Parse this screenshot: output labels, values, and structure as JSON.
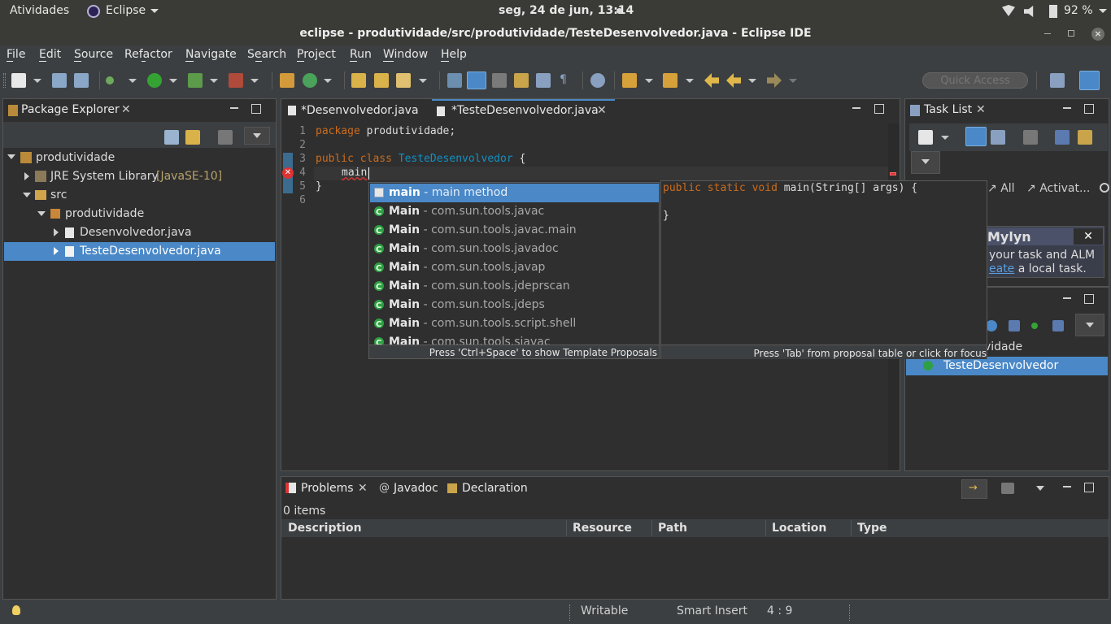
{
  "system": {
    "activities": "Atividades",
    "app_menu": "Eclipse",
    "clock": "seg, 24 de jun, 13:14",
    "battery": "92 %"
  },
  "window": {
    "title": "eclipse - produtividade/src/produtividade/TesteDesenvolvedor.java - Eclipse IDE"
  },
  "menu": [
    "File",
    "Edit",
    "Source",
    "Refactor",
    "Navigate",
    "Search",
    "Project",
    "Run",
    "Window",
    "Help"
  ],
  "menu_underline": [
    "F",
    "E",
    "S",
    "f",
    "N",
    "a",
    "P",
    "R",
    "W",
    "H"
  ],
  "toolbar": {
    "quick_access_placeholder": "Quick Access"
  },
  "package_explorer": {
    "title": "Package Explorer",
    "tree": {
      "project": "produtividade",
      "jre": "JRE System Library",
      "jre_version": "[JavaSE-10]",
      "src": "src",
      "package": "produtividade",
      "file1": "Desenvolvedor.java",
      "file2": "TesteDesenvolvedor.java"
    }
  },
  "editor": {
    "tabs": [
      "*Desenvolvedor.java",
      "*TesteDesenvolvedor.java"
    ],
    "lines": {
      "n1": "1",
      "n2": "2",
      "n3": "3",
      "n4": "4",
      "n5": "5",
      "n6": "6",
      "l1_kw": "package",
      "l1_rest": " produtividade;",
      "l3_kw1": "public",
      "l3_kw2": "class",
      "l3_cls": "TesteDesenvolvedor",
      "l3_rest": " {",
      "l4": "main",
      "l5": "}"
    }
  },
  "content_assist": {
    "proposals": [
      {
        "name": "main",
        "qual": " - main method"
      },
      {
        "name": "Main",
        "qual": " - com.sun.tools.javac"
      },
      {
        "name": "Main",
        "qual": " - com.sun.tools.javac.main"
      },
      {
        "name": "Main",
        "qual": " - com.sun.tools.javadoc"
      },
      {
        "name": "Main",
        "qual": " - com.sun.tools.javap"
      },
      {
        "name": "Main",
        "qual": " - com.sun.tools.jdeprscan"
      },
      {
        "name": "Main",
        "qual": " - com.sun.tools.jdeps"
      },
      {
        "name": "Main",
        "qual": " - com.sun.tools.script.shell"
      },
      {
        "name": "Main",
        "qual": " - com.sun.tools.sjavac"
      }
    ],
    "hint_left": "Press 'Ctrl+Space' to show Template Proposals",
    "hint_right": "Press 'Tab' from proposal table or click for focus",
    "preview_kw1": "public",
    "preview_kw2": "static",
    "preview_kw3": "void",
    "preview_rest": " main(String[] args) {",
    "preview_close": "}"
  },
  "task_list": {
    "title": "Task List",
    "filter_all": "All",
    "filter_activate": "Activat...",
    "mylyn_title": "Mylyn",
    "mylyn_text1": "your task and ALM",
    "mylyn_link": "eate",
    "mylyn_text2": " a local task."
  },
  "outline": {
    "item_partial": "vidade",
    "item": "TesteDesenvolvedor"
  },
  "bottom": {
    "tabs": [
      "Problems",
      "Javadoc",
      "Declaration"
    ],
    "count": "0 items",
    "columns": [
      "Description",
      "Resource",
      "Path",
      "Location",
      "Type"
    ]
  },
  "status": {
    "writable": "Writable",
    "insert_mode": "Smart Insert",
    "position": "4 : 9"
  },
  "colors": {
    "accent": "#4a88c7",
    "keyword": "#cc6c1d",
    "class_name": "#1290c3"
  }
}
